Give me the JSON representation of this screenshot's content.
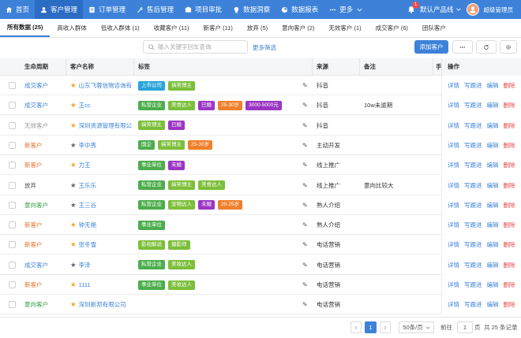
{
  "nav": {
    "items": [
      {
        "label": "首页",
        "icon": "home-icon",
        "active": false
      },
      {
        "label": "客户管理",
        "icon": "users-icon",
        "active": true
      },
      {
        "label": "订单管理",
        "icon": "order-icon",
        "active": false
      },
      {
        "label": "售后管理",
        "icon": "wrench-icon",
        "active": false
      },
      {
        "label": "项目审批",
        "icon": "approval-icon",
        "active": false
      },
      {
        "label": "数据洞察",
        "icon": "insight-icon",
        "active": false
      },
      {
        "label": "数据报表",
        "icon": "report-icon",
        "active": false
      },
      {
        "label": "更多",
        "icon": "more-icon",
        "active": false
      }
    ],
    "notification_count": "1",
    "product_line": "默认产品线",
    "user": "超级管理员"
  },
  "tabs": [
    {
      "label": "所有数据 (25)",
      "active": true
    },
    {
      "label": "高收入群体",
      "active": false
    },
    {
      "label": "低收入群体 (1)",
      "active": false
    },
    {
      "label": "收藏客户 (11)",
      "active": false
    },
    {
      "label": "新客户 (11)",
      "active": false
    },
    {
      "label": "放弃 (5)",
      "active": false
    },
    {
      "label": "意向客户 (2)",
      "active": false
    },
    {
      "label": "无效客户 (1)",
      "active": false
    },
    {
      "label": "成交客户 (6)",
      "active": false
    },
    {
      "label": "团队客户",
      "active": false
    }
  ],
  "toolbar": {
    "search_placeholder": "输入关键字回车查询",
    "more_filter": "更多筛选",
    "add_customer": "添加客户"
  },
  "table": {
    "headers": {
      "stage": "生命周期",
      "name": "客户名称",
      "tags": "标签",
      "source": "来源",
      "note": "备注",
      "extra": "手",
      "ops": "操作"
    },
    "ops_labels": [
      "详情",
      "写跟进",
      "编辑",
      "删除"
    ],
    "rows": [
      {
        "stage": "成交客户",
        "stage_color": "#3d82d8",
        "starred": true,
        "name": "山东飞蓉信物咨询有",
        "tags": [
          {
            "text": "上市公司",
            "color": "#2aa5d8"
          },
          {
            "text": "搞笑博主",
            "color": "#7cbf3a"
          }
        ],
        "source": "抖音",
        "note": ""
      },
      {
        "stage": "成交客户",
        "stage_color": "#3d82d8",
        "starred": true,
        "name": "王cc",
        "tags": [
          {
            "text": "私营企业",
            "color": "#4cae4c"
          },
          {
            "text": "美食达人",
            "color": "#7cbf3a"
          },
          {
            "text": "已婚",
            "color": "#9b36c4"
          },
          {
            "text": "25-30岁",
            "color": "#f0802b"
          },
          {
            "text": "3000-5000元",
            "color": "#9b36c4"
          }
        ],
        "source": "抖音",
        "note": "10w未逾期"
      },
      {
        "stage": "无效客户",
        "stage_color": "#999999",
        "starred": true,
        "name": "深圳资源管理有限公",
        "tags": [
          {
            "text": "搞笑博主",
            "color": "#7cbf3a"
          },
          {
            "text": "已婚",
            "color": "#9b36c4"
          }
        ],
        "source": "抖音",
        "note": ""
      },
      {
        "stage": "新客户",
        "stage_color": "#e8712a",
        "starred": false,
        "name": "李中秀",
        "tags": [
          {
            "text": "国企",
            "color": "#4cae4c"
          },
          {
            "text": "搞笑博主",
            "color": "#7cbf3a"
          },
          {
            "text": "25-30岁",
            "color": "#f0802b"
          }
        ],
        "source": "主动开发",
        "note": ""
      },
      {
        "stage": "新客户",
        "stage_color": "#e8712a",
        "starred": true,
        "name": "力王",
        "tags": [
          {
            "text": "事业单位",
            "color": "#4cae4c"
          },
          {
            "text": "未婚",
            "color": "#9b36c4"
          }
        ],
        "source": "线上推广",
        "note": ""
      },
      {
        "stage": "放弃",
        "stage_color": "#555555",
        "starred": false,
        "name": "王乐乐",
        "tags": [
          {
            "text": "私营企业",
            "color": "#4cae4c"
          },
          {
            "text": "搞笑博主",
            "color": "#7cbf3a"
          },
          {
            "text": "美食达人",
            "color": "#7cbf3a"
          }
        ],
        "source": "线上推广",
        "note": "意向比较大"
      },
      {
        "stage": "意向客户",
        "stage_color": "#2f9e44",
        "starred": false,
        "name": "王三谷",
        "tags": [
          {
            "text": "私营企业",
            "color": "#4cae4c"
          },
          {
            "text": "宠物达人",
            "color": "#7cbf3a"
          },
          {
            "text": "未婚",
            "color": "#9b36c4"
          },
          {
            "text": "20-25岁",
            "color": "#f0802b"
          }
        ],
        "source": "熟人介绍",
        "note": ""
      },
      {
        "stage": "新客户",
        "stage_color": "#e8712a",
        "starred": true,
        "name": "钟无艳",
        "tags": [
          {
            "text": "事业单位",
            "color": "#4cae4c"
          }
        ],
        "source": "熟人介绍",
        "note": ""
      },
      {
        "stage": "新客户",
        "stage_color": "#e8712a",
        "starred": true,
        "name": "张冬雪",
        "tags": [
          {
            "text": "影视解说",
            "color": "#7cbf3a"
          },
          {
            "text": "摄影师",
            "color": "#7cbf3a"
          }
        ],
        "source": "电话营销",
        "note": ""
      },
      {
        "stage": "成交客户",
        "stage_color": "#3d82d8",
        "starred": false,
        "name": "李泽",
        "tags": [
          {
            "text": "私营企业",
            "color": "#4cae4c"
          },
          {
            "text": "美妆达人",
            "color": "#7cbf3a"
          }
        ],
        "source": "电话营销",
        "note": ""
      },
      {
        "stage": "新客户",
        "stage_color": "#e8712a",
        "starred": true,
        "name": "1111",
        "tags": [
          {
            "text": "事业单位",
            "color": "#4cae4c"
          },
          {
            "text": "美妆达人",
            "color": "#7cbf3a"
          }
        ],
        "source": "电话营销",
        "note": ""
      },
      {
        "stage": "意向客户",
        "stage_color": "#2f9e44",
        "starred": true,
        "name": "深圳新邦有限公司",
        "tags": [],
        "source": "电话营销",
        "note": ""
      }
    ]
  },
  "pager": {
    "current_page": "1",
    "page_size": "50条/页",
    "goto_label": "前往",
    "goto_value": "1",
    "page_unit": "页",
    "total": "共 25 条记录"
  }
}
